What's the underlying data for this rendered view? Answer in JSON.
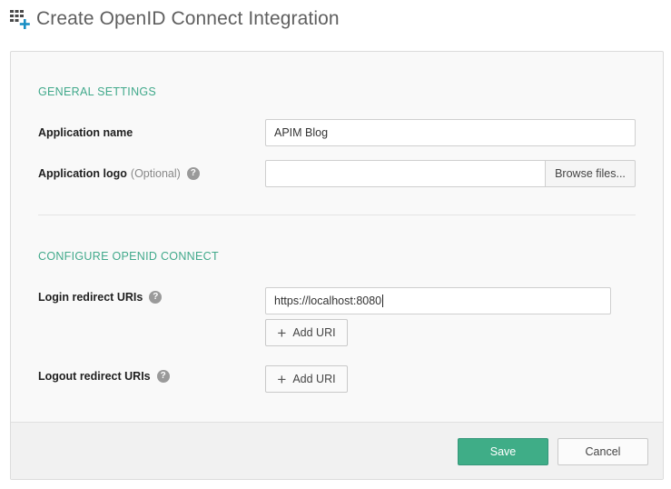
{
  "header": {
    "title": "Create OpenID Connect Integration",
    "icon": "apps-add-icon"
  },
  "general": {
    "section_title": "GENERAL SETTINGS",
    "app_name_label": "Application name",
    "app_name_value": "APIM Blog",
    "app_logo_label": "Application logo",
    "app_logo_optional": "(Optional)",
    "app_logo_value": "",
    "browse_label": "Browse files..."
  },
  "oidc": {
    "section_title": "CONFIGURE OPENID CONNECT",
    "login_label": "Login redirect URIs",
    "login_uri_value": "https://localhost:8080",
    "add_uri_label": "Add URI",
    "logout_label": "Logout redirect URIs",
    "logout_add_label": "Add URI"
  },
  "help_glyph": "?",
  "footer": {
    "save_label": "Save",
    "cancel_label": "Cancel"
  },
  "colors": {
    "accent": "#41a98b",
    "save_bg": "#3fad87"
  }
}
